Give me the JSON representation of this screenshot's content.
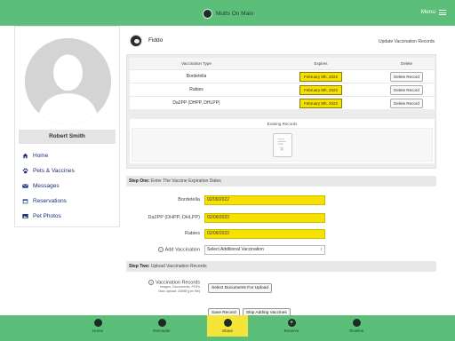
{
  "app": {
    "title": "Mutts On Main",
    "menu_label": "Menu"
  },
  "sidebar": {
    "user_name": "Robert Smith",
    "items": [
      {
        "label": "Home",
        "icon": "home-icon"
      },
      {
        "label": "Pets & Vaccines",
        "icon": "paw-icon"
      },
      {
        "label": "Messages",
        "icon": "envelope-icon"
      },
      {
        "label": "Reservations",
        "icon": "calendar-icon"
      },
      {
        "label": "Pet Photos",
        "icon": "image-icon"
      }
    ]
  },
  "pet": {
    "name": "Fiddo",
    "update_link": "Update Vaccination Records"
  },
  "vaccine_table": {
    "headers": {
      "type": "Vaccination Type",
      "expires": "Expires",
      "delete": "Delete"
    },
    "rows": [
      {
        "type": "Bordetella",
        "expires": "February 9th, 2022",
        "delete_label": "Delete Record"
      },
      {
        "type": "Rabies",
        "expires": "February 9th, 2022",
        "delete_label": "Delete Record"
      },
      {
        "type": "Da2PP (DHPP, DHLPP)",
        "expires": "February 9th, 2022",
        "delete_label": "Delete Record"
      }
    ],
    "existing_records_label": "Existing Records"
  },
  "step_one": {
    "bold": "Step One:",
    "text": " Enter The Vaccine Expiration Dates",
    "fields": [
      {
        "label": "Bordetella",
        "value": "02/09/2022"
      },
      {
        "label": "Da2PP (DHPP, DHLPP)",
        "value": "02/09/2022"
      },
      {
        "label": "Rabies",
        "value": "02/09/2022"
      }
    ],
    "add_vaccination_label": "Add Vaccination",
    "add_vaccination_select": "Select Additional Vaccination"
  },
  "step_two": {
    "bold": "Step Two:",
    "text": " Upload Vaccination Records",
    "label": "Vaccination Records",
    "sub1": "Images, Documents, PDFs",
    "sub2": "Max upload: 20MB (per file)",
    "select_button": "Select Documents For Upload",
    "save_button": "Save Record",
    "skip_button": "Skip Adding Vaccines"
  },
  "bottom_nav": [
    {
      "label": "Home",
      "icon": "home-icon"
    },
    {
      "label": "Reminder",
      "icon": "bell-icon"
    },
    {
      "label": "Share",
      "icon": "share-icon",
      "active": true
    },
    {
      "label": "Reserve",
      "icon": "plus-icon"
    },
    {
      "label": "Timeline",
      "icon": "timeline-icon"
    }
  ],
  "colors": {
    "brand_green": "#5bbf7a",
    "highlight_yellow": "#f7e100",
    "nav_link": "#1a2e7a"
  }
}
